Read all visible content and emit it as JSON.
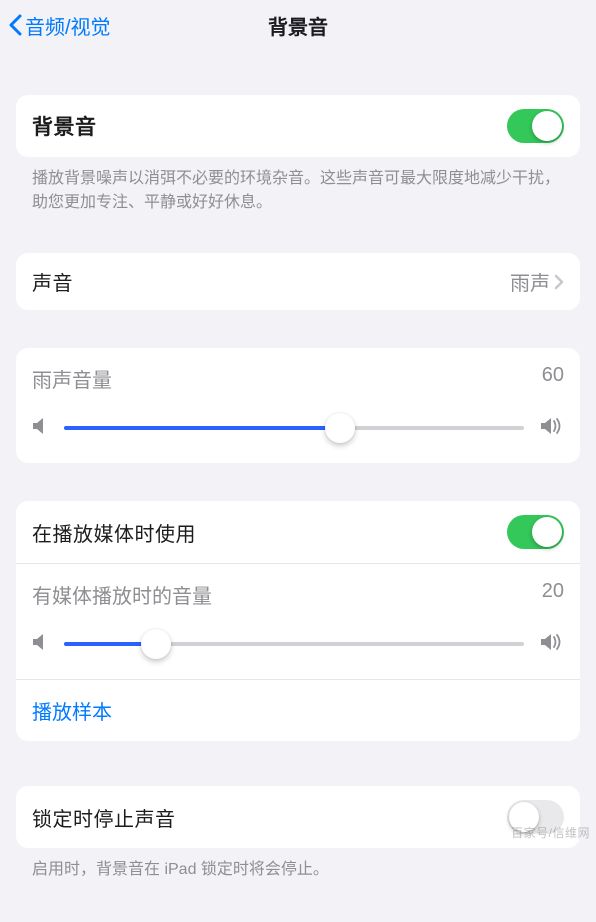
{
  "nav": {
    "back_label": "音频/视觉",
    "title": "背景音"
  },
  "group1": {
    "toggle_label": "背景音",
    "toggle_on": true,
    "footer": "播放背景噪声以消弭不必要的环境杂音。这些声音可最大限度地减少干扰，助您更加专注、平静或好好休息。"
  },
  "sound_row": {
    "label": "声音",
    "value": "雨声"
  },
  "vol1": {
    "label": "雨声音量",
    "value": 60
  },
  "media": {
    "toggle_label": "在播放媒体时使用",
    "toggle_on": true,
    "vol_label": "有媒体播放时的音量",
    "vol_value": 20,
    "sample_label": "播放样本"
  },
  "lock": {
    "toggle_label": "锁定时停止声音",
    "toggle_on": false,
    "footer": "启用时，背景音在 iPad 锁定时将会停止。"
  },
  "watermark": "百家号/信维网",
  "colors": {
    "accent": "#007aff",
    "green": "#34c759",
    "blue_slider": "#2b62ff",
    "grey_text": "#8e8e93",
    "bg": "#f2f2f7"
  }
}
